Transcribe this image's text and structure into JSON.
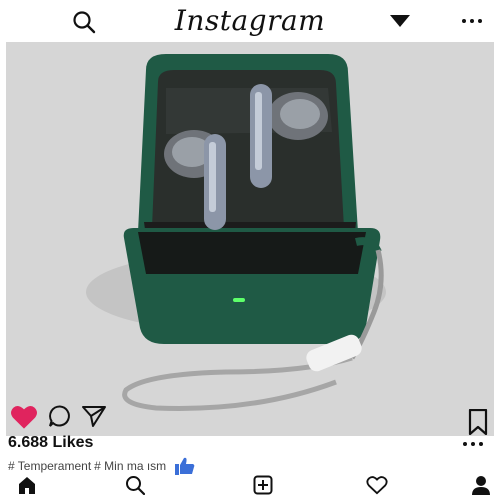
{
  "header": {
    "brand": "Instagram",
    "search_icon": "search-icon",
    "dropdown_icon": "dropdown-arrow-icon",
    "more_icon": "more-dots-icon"
  },
  "post": {
    "image_description_icon": "earbuds-product-photo",
    "likes_text": "6.688 Likes",
    "hashtags": [
      "# Temperament",
      "# Min ma ısm"
    ],
    "liked": true,
    "colors": {
      "heart": "#e0245e",
      "thumb": "#3b6fd8",
      "case_green": "#1f5a45"
    }
  },
  "nav": {
    "items": [
      "home-icon",
      "search-icon",
      "add-post-icon",
      "activity-heart-icon",
      "profile-icon"
    ]
  }
}
